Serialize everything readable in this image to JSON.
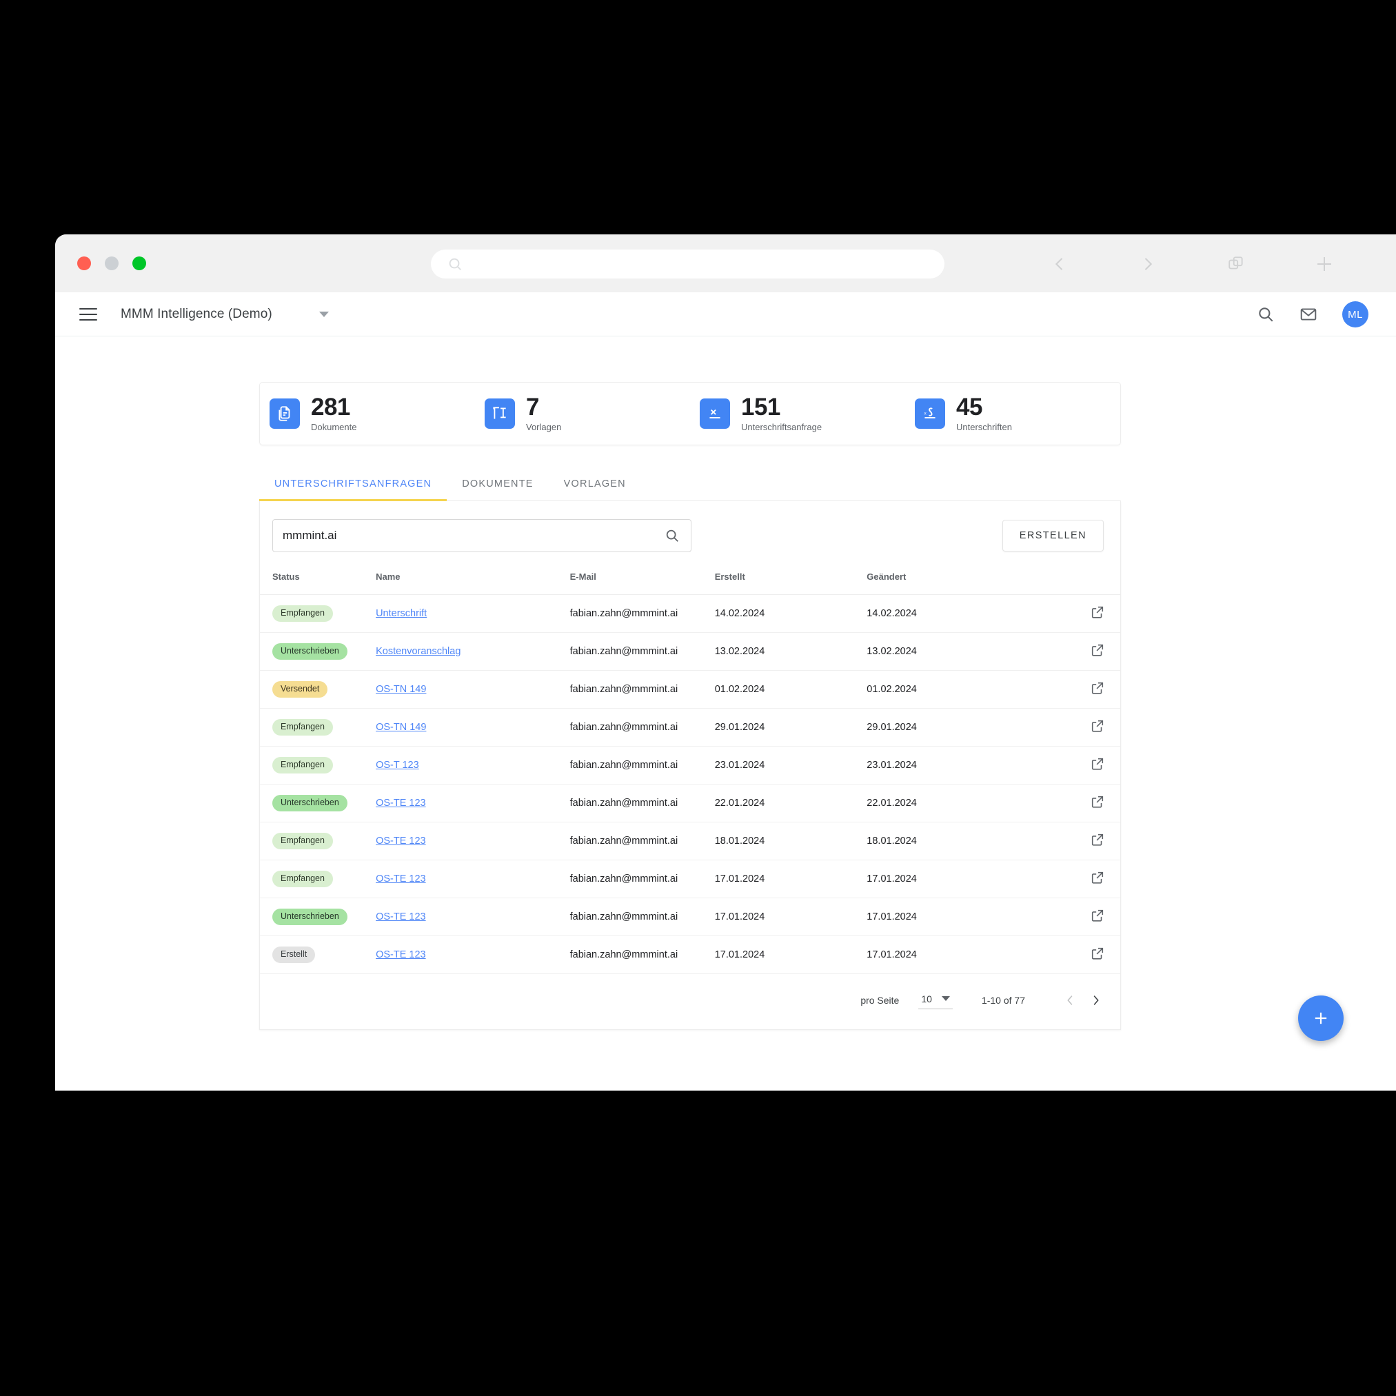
{
  "browser": {
    "url_value": "",
    "url_placeholder": "",
    "actions": [
      "back",
      "forward",
      "tabs",
      "new-tab"
    ]
  },
  "header": {
    "app_title": "MMM Intelligence (Demo)",
    "icons": [
      "search-icon",
      "mail-icon"
    ],
    "avatar_initials": "ML"
  },
  "stats": [
    {
      "value": "281",
      "label": "Dokumente",
      "icon": "document-copy-icon"
    },
    {
      "value": "7",
      "label": "Vorlagen",
      "icon": "template-icon"
    },
    {
      "value": "151",
      "label": "Unterschriftsanfrage",
      "icon": "signature-request-icon"
    },
    {
      "value": "45",
      "label": "Unterschriften",
      "icon": "signature-icon"
    }
  ],
  "tabs": [
    {
      "label": "UNTERSCHRIFTSANFRAGEN",
      "active": true
    },
    {
      "label": "DOKUMENTE",
      "active": false
    },
    {
      "label": "VORLAGEN",
      "active": false
    }
  ],
  "toolbar": {
    "search_value": "mmmint.ai",
    "search_placeholder": "Suchen",
    "create_label": "ERSTELLEN"
  },
  "table": {
    "columns": [
      "Status",
      "Name",
      "E-Mail",
      "Erstellt",
      "Geändert",
      ""
    ],
    "rows": [
      {
        "status": "Empfangen",
        "status_tone": "green-light",
        "name": "Unterschrift",
        "email": "fabian.zahn@mmmint.ai",
        "created": "14.02.2024",
        "changed": "14.02.2024"
      },
      {
        "status": "Unterschrieben",
        "status_tone": "green-strong",
        "name": "Kostenvoranschlag",
        "email": "fabian.zahn@mmmint.ai",
        "created": "13.02.2024",
        "changed": "13.02.2024"
      },
      {
        "status": "Versendet",
        "status_tone": "yellow",
        "name": "OS-TN 149",
        "email": "fabian.zahn@mmmint.ai",
        "created": "01.02.2024",
        "changed": "01.02.2024"
      },
      {
        "status": "Empfangen",
        "status_tone": "green-light",
        "name": "OS-TN 149",
        "email": "fabian.zahn@mmmint.ai",
        "created": "29.01.2024",
        "changed": "29.01.2024"
      },
      {
        "status": "Empfangen",
        "status_tone": "green-light",
        "name": "OS-T 123",
        "email": "fabian.zahn@mmmint.ai",
        "created": "23.01.2024",
        "changed": "23.01.2024"
      },
      {
        "status": "Unterschrieben",
        "status_tone": "green-strong",
        "name": "OS-TE 123",
        "email": "fabian.zahn@mmmint.ai",
        "created": "22.01.2024",
        "changed": "22.01.2024"
      },
      {
        "status": "Empfangen",
        "status_tone": "green-light",
        "name": "OS-TE 123",
        "email": "fabian.zahn@mmmint.ai",
        "created": "18.01.2024",
        "changed": "18.01.2024"
      },
      {
        "status": "Empfangen",
        "status_tone": "green-light",
        "name": "OS-TE 123",
        "email": "fabian.zahn@mmmint.ai",
        "created": "17.01.2024",
        "changed": "17.01.2024"
      },
      {
        "status": "Unterschrieben",
        "status_tone": "green-strong",
        "name": "OS-TE 123",
        "email": "fabian.zahn@mmmint.ai",
        "created": "17.01.2024",
        "changed": "17.01.2024"
      },
      {
        "status": "Erstellt",
        "status_tone": "gray",
        "name": "OS-TE 123",
        "email": "fabian.zahn@mmmint.ai",
        "created": "17.01.2024",
        "changed": "17.01.2024"
      }
    ]
  },
  "pagination": {
    "per_page_label": "pro Seite",
    "per_page_value": "10",
    "range": "1-10 of 77"
  },
  "fab": {
    "icon": "plus-icon"
  },
  "colors": {
    "accent": "#4285f4",
    "tab_active_text": "#4f86f7",
    "tab_underline": "#f5d44e",
    "badge_green_light": "#d9efd0",
    "badge_green_strong": "#a5e2a2",
    "badge_yellow": "#f5dd92",
    "badge_gray": "#e3e3e3",
    "link": "#4f86f7"
  }
}
